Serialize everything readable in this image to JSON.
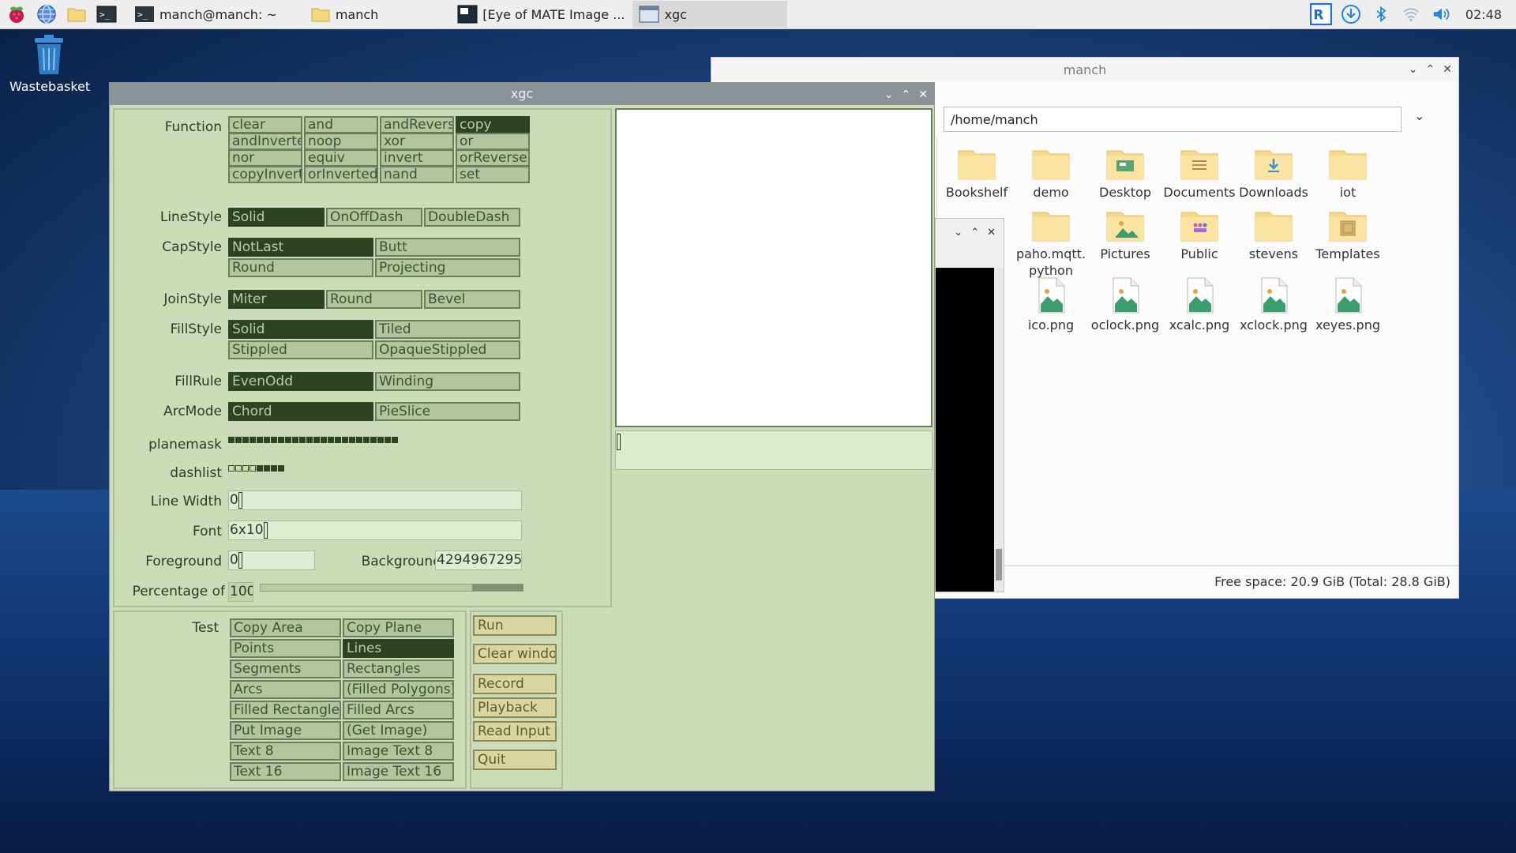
{
  "taskbar": {
    "tasks": [
      {
        "label": "manch@manch: ~"
      },
      {
        "label": "manch"
      },
      {
        "label": "[Eye of MATE Image ..."
      },
      {
        "label": "xgc"
      }
    ],
    "clock": "02:48"
  },
  "desktop": {
    "wastebasket_label": "Wastebasket"
  },
  "file_manager": {
    "title": "manch",
    "path": "/home/manch",
    "items": [
      {
        "label": "Bookshelf"
      },
      {
        "label": "demo"
      },
      {
        "label": "Desktop"
      },
      {
        "label": "Documents"
      },
      {
        "label": "Downloads"
      },
      {
        "label": "iot"
      },
      {
        "label": "paho.mqtt.\npython"
      },
      {
        "label": "Pictures"
      },
      {
        "label": "Public"
      },
      {
        "label": "stevens"
      },
      {
        "label": "Templates"
      },
      {
        "label": "ico.png"
      },
      {
        "label": "oclock.png"
      },
      {
        "label": "xcalc.png"
      },
      {
        "label": "xclock.png"
      },
      {
        "label": "xeyes.png"
      }
    ],
    "status": "Free space: 20.9 GiB (Total: 28.8 GiB)"
  },
  "xgc": {
    "title": "xgc",
    "labels": {
      "function": "Function",
      "linestyle": "LineStyle",
      "capstyle": "CapStyle",
      "joinstyle": "JoinStyle",
      "fillstyle": "FillStyle",
      "fillrule": "FillRule",
      "arcmode": "ArcMode",
      "planemask": "planemask",
      "dashlist": "dashlist",
      "linewidth": "Line Width",
      "font": "Font",
      "foreground": "Foreground",
      "background": "Background",
      "percentage": "Percentage of",
      "test": "Test"
    },
    "function": [
      "clear",
      "and",
      "andReverse",
      "copy",
      "andInverted",
      "noop",
      "xor",
      "or",
      "nor",
      "equiv",
      "invert",
      "orReverse",
      "copyInverted",
      "orInverted",
      "nand",
      "set"
    ],
    "function_selected": "copy",
    "linestyle": [
      "Solid",
      "OnOffDash",
      "DoubleDash"
    ],
    "capstyle": [
      "NotLast",
      "Butt",
      "Round",
      "Projecting"
    ],
    "joinstyle": [
      "Miter",
      "Round",
      "Bevel"
    ],
    "fillstyle": [
      "Solid",
      "Tiled",
      "Stippled",
      "OpaqueStippled"
    ],
    "fillrule": [
      "EvenOdd",
      "Winding"
    ],
    "arcmode": [
      "Chord",
      "PieSlice"
    ],
    "planemask_bits": 24,
    "dashlist_bits": [
      0,
      0,
      0,
      0,
      1,
      1,
      1,
      1
    ],
    "linewidth_value": "0",
    "font_value": "6x10",
    "foreground_value": "0",
    "background_value": "4294967295",
    "percentage_value": "100",
    "tests": [
      "Copy Area",
      "Copy Plane",
      "Points",
      "Lines",
      "Segments",
      "Rectangles",
      "Arcs",
      "(Filled Polygons)",
      "Filled Rectangles",
      "Filled Arcs",
      "Put Image",
      "(Get Image)",
      "Text 8",
      "Image Text 8",
      "Text 16",
      "Image Text 16"
    ],
    "test_selected": "Lines",
    "actions": [
      "Run",
      "Clear window",
      "Record",
      "Playback",
      "Read Input",
      "Quit"
    ]
  }
}
